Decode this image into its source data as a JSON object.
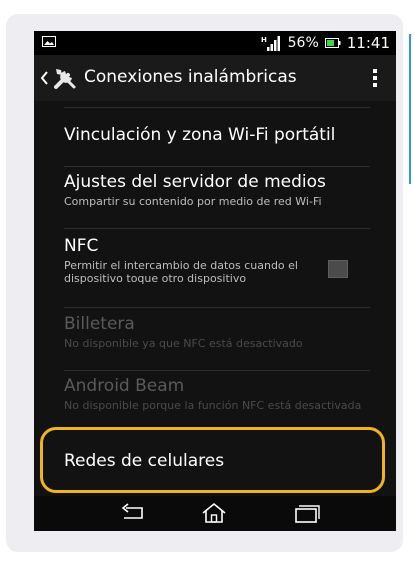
{
  "status_bar": {
    "battery_percent": "56%",
    "time": "11:41",
    "signal_badge": "H",
    "icons": [
      "gallery-icon",
      "signal-icon",
      "battery-icon"
    ]
  },
  "action_bar": {
    "title": "Conexiones inalámbricas",
    "icons": [
      "back-chevron-icon",
      "tools-icon",
      "overflow-menu-icon"
    ]
  },
  "settings": {
    "items": [
      {
        "title": "Vinculación y zona Wi-Fi portátil",
        "subtitle": "",
        "enabled": true
      },
      {
        "title": "Ajustes del servidor de medios",
        "subtitle": "Compartir su contenido por medio de red Wi-Fi",
        "enabled": true
      },
      {
        "title": "NFC",
        "subtitle": "Permitir el intercambio de datos cuando el dispositivo toque otro dispositivo",
        "enabled": true,
        "checked": false
      },
      {
        "title": "Billetera",
        "subtitle": "No disponible ya que NFC está desactivado",
        "enabled": false
      },
      {
        "title": "Android Beam",
        "subtitle": "No disponible porque la función NFC está desactivada",
        "enabled": false
      },
      {
        "title": "Redes de celulares",
        "subtitle": "",
        "enabled": true
      }
    ]
  },
  "nav_bar": {
    "icons": [
      "back-icon",
      "home-icon",
      "recent-apps-icon"
    ]
  },
  "colors": {
    "highlight": "#f2b321",
    "accent_line": "#2b9be0",
    "background": "#121212"
  }
}
